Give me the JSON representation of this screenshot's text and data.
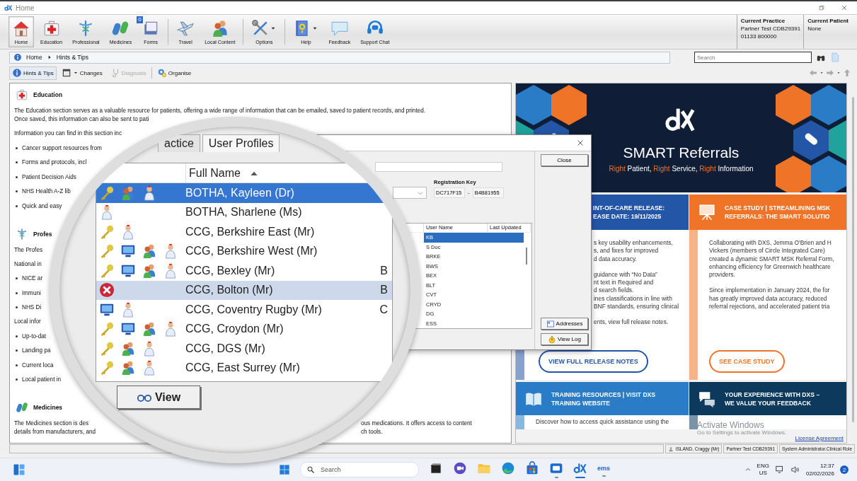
{
  "window": {
    "title": "Home"
  },
  "ribbon": {
    "groups": [
      [
        {
          "label": "Home",
          "selected": true,
          "dropdown": false
        },
        {
          "label": "Education",
          "selected": false,
          "dropdown": false
        },
        {
          "label": "Professional",
          "selected": false,
          "dropdown": false
        },
        {
          "label": "Medicines",
          "selected": false,
          "dropdown": false
        },
        {
          "label": "Forms",
          "selected": false,
          "dropdown": false,
          "badge": "0"
        }
      ],
      [
        {
          "label": "Travel",
          "selected": false,
          "dropdown": false
        },
        {
          "label": "Local Content",
          "selected": false,
          "dropdown": false
        }
      ],
      [
        {
          "label": "Options",
          "selected": false,
          "dropdown": true
        }
      ],
      [
        {
          "label": "Help",
          "selected": false,
          "dropdown": true
        },
        {
          "label": "Feedback",
          "selected": false,
          "dropdown": false
        },
        {
          "label": "Support Chat",
          "selected": false,
          "dropdown": false
        }
      ]
    ]
  },
  "context": [
    {
      "label": "Current Practice",
      "lines": [
        "Partner Test CDB29391",
        "01133 800000"
      ]
    },
    {
      "label": "Current Patient",
      "lines": [
        "None"
      ]
    }
  ],
  "breadcrumb": [
    "Home",
    "Hints & Tips"
  ],
  "search": {
    "placeholder": "Search"
  },
  "toolbar": [
    {
      "label": "Hints & Tips",
      "selected": true,
      "disabled": false,
      "dropdown": false
    },
    {
      "label": "Changes",
      "selected": false,
      "disabled": false,
      "dropdown": true
    },
    {
      "label": "Diagnosis",
      "selected": false,
      "disabled": true,
      "dropdown": false
    },
    {
      "label": "Organise",
      "selected": false,
      "disabled": false,
      "dropdown": false
    }
  ],
  "sections": [
    {
      "heading": "Education",
      "blocks": [
        {
          "kind": "para",
          "lines": [
            "The Education section serves as a valuable resource for patients, offering a wide range of information that can be emailed, saved to patient records, and printed.",
            "Once saved, this information can also be sent to pati"
          ]
        },
        {
          "kind": "para",
          "lines": [
            "Information you can find in this section inc"
          ]
        },
        {
          "kind": "bullets",
          "items": [
            "Cancer support resources from",
            "Forms and protocols, incl",
            "Patient Decision Aids",
            "NHS Health A-Z lib",
            "Quick and easy"
          ]
        }
      ]
    },
    {
      "heading": "Profes",
      "blocks": [
        {
          "kind": "para",
          "lines": [
            "The Profes"
          ]
        },
        {
          "kind": "para",
          "lines": [
            "National in"
          ]
        },
        {
          "kind": "bullets",
          "items": [
            "NICE ar",
            "Immuni",
            "NHS Di"
          ]
        },
        {
          "kind": "para",
          "lines": [
            "Local infor"
          ]
        },
        {
          "kind": "bullets",
          "items": [
            "Up-to-dat",
            "Landing pa",
            "Current loca",
            "Local patient in"
          ]
        }
      ]
    },
    {
      "heading": "Medicines",
      "blocks": [
        {
          "kind": "split",
          "lines": [
            {
              "left": "The Medicines section is des",
              "right": "ous medications. It offers access to content"
            },
            {
              "left": "details from manufacturers, and",
              "right": "ch tools."
            }
          ]
        }
      ]
    }
  ],
  "banner": {
    "title": "SMART Referrals",
    "tagline": [
      {
        "text": "Right",
        "accent": true
      },
      {
        "text": " Patient, ",
        "accent": false
      },
      {
        "text": "Right",
        "accent": true
      },
      {
        "text": " Service, ",
        "accent": false
      },
      {
        "text": "Right",
        "accent": true
      },
      {
        "text": " Information",
        "accent": false
      }
    ]
  },
  "cards": [
    [
      {
        "color": "#2456a8",
        "title_lines": [
          "INT-OF-CARE RELEASE:",
          "EASE DATE: 19/11/2025"
        ],
        "body": [
          [
            "s key usability enhancements,",
            "s, and fixes for improved",
            "d data accuracy."
          ],
          [
            "guidance with “No Data”",
            "nt text in Required and",
            "d search fields.",
            "ines classifications in line with",
            "BNF standards, ensuring clinical"
          ],
          [
            "ents, view full release notes."
          ]
        ],
        "button": "VIEW FULL RELEASE NOTES"
      },
      {
        "color": "#f07427",
        "title_lines": [
          "CASE STUDY | STREAMLINING MSK",
          "REFERRALS: THE SMART SOLUTIO"
        ],
        "body": [
          [
            "Collaborating with DXS, Jemma O'Brien and H",
            "Vickers (members of Circle Integrated Care)",
            "created a dynamic SMART MSK Referral Form,",
            "enhancing efficiency for Greenwich healthcare",
            "providers."
          ],
          [
            "Since implementation in January 2024, the for",
            "has greatly improved data accuracy, reduced",
            "referral rejections, and accelerated patient tria"
          ]
        ],
        "button": "SEE CASE STUDY"
      }
    ],
    [
      {
        "color": "#2a7cc7",
        "title_lines": [
          "TRAINING RESOURCES | VISIT DXS",
          "TRAINING WEBSITE"
        ],
        "body": [
          [
            "Discover how to access quick assistance using the"
          ]
        ]
      },
      {
        "color": "#0d3a5c",
        "title_lines": [
          "YOUR EXPERIENCE WITH DXS –",
          "WE VALUE YOUR FEEDBACK"
        ]
      }
    ]
  ],
  "license": "License Agreement",
  "os_notice": {
    "title": "Activate Windows",
    "subtitle": "Go to Settings to activate Windows."
  },
  "dialog": {
    "top_buttons": [
      {
        "label": "Close"
      }
    ],
    "bottom_buttons": [
      {
        "label": "Addresses"
      },
      {
        "label": "View Log"
      }
    ],
    "registration": {
      "label": "Registration Key",
      "parts": [
        "DC717F15",
        "B4B81955"
      ],
      "separator": "-"
    },
    "list": {
      "columns": [
        "User Name",
        "Last Updated"
      ],
      "rows": [
        {
          "user_name": "KB",
          "selected": true
        },
        {
          "user_name": "S Doc",
          "selected": false
        },
        {
          "user_name": "BRKE",
          "selected": false
        },
        {
          "user_name": "BWS",
          "selected": false
        },
        {
          "user_name": "BEX",
          "selected": false
        },
        {
          "user_name": "BLT",
          "selected": false
        },
        {
          "user_name": "CVT",
          "selected": false
        },
        {
          "user_name": "CRYD",
          "selected": false
        },
        {
          "user_name": "DG",
          "selected": false
        },
        {
          "user_name": "ESS",
          "selected": false
        }
      ]
    }
  },
  "magnifier": {
    "tabs": [
      {
        "label": "actice",
        "selected": false
      },
      {
        "label": "User Profiles",
        "selected": true
      }
    ],
    "column": {
      "label": "Full Name",
      "sorted_ascending": true
    },
    "rows": [
      {
        "icons": [
          {
            "kind": "key"
          },
          {
            "kind": "people"
          },
          {
            "kind": "doctor"
          }
        ],
        "name": "BOTHA, Kayleen (Dr)",
        "selected": true,
        "highlighted": false
      },
      {
        "icons": [
          {
            "kind": "doctor"
          }
        ],
        "name": "BOTHA, Sharlene (Ms)",
        "selected": false,
        "highlighted": false
      },
      {
        "icons": [
          {
            "kind": "key"
          },
          {
            "kind": "doctor"
          }
        ],
        "name": "CCG, Berkshire East (Mr)",
        "selected": false,
        "highlighted": false
      },
      {
        "icons": [
          {
            "kind": "key"
          },
          {
            "kind": "monitor"
          },
          {
            "kind": "people"
          },
          {
            "kind": "doctor"
          }
        ],
        "name": "CCG, Berkshire West (Mr)",
        "selected": false,
        "highlighted": false
      },
      {
        "icons": [
          {
            "kind": "key"
          },
          {
            "kind": "monitor"
          },
          {
            "kind": "people"
          },
          {
            "kind": "doctor"
          }
        ],
        "name": "CCG, Bexley (Mr)",
        "column_2": "B",
        "selected": false,
        "highlighted": false
      },
      {
        "icons": [
          {
            "kind": "error"
          }
        ],
        "name": "CCG, Bolton (Mr)",
        "column_2": "B",
        "selected": false,
        "highlighted": true
      },
      {
        "icons": [
          {
            "kind": "monitor"
          },
          {
            "kind": "doctor"
          }
        ],
        "name": "CCG, Coventry Rugby (Mr)",
        "column_2": "C",
        "selected": false,
        "highlighted": false
      },
      {
        "icons": [
          {
            "kind": "key"
          },
          {
            "kind": "monitor"
          },
          {
            "kind": "people"
          },
          {
            "kind": "doctor"
          }
        ],
        "name": "CCG, Croydon (Mr)",
        "selected": false,
        "highlighted": false
      },
      {
        "icons": [
          {
            "kind": "key"
          },
          {
            "kind": "people"
          },
          {
            "kind": "doctor"
          }
        ],
        "name": "CCG, DGS (Mr)",
        "selected": false,
        "highlighted": false
      },
      {
        "icons": [
          {
            "kind": "key"
          },
          {
            "kind": "people"
          },
          {
            "kind": "doctor"
          }
        ],
        "name": "CCG, East Surrey (Mr)",
        "selected": false,
        "highlighted": false
      }
    ],
    "button": {
      "label": "View"
    }
  },
  "status_bar": {
    "user": "ISLAND, Craggy (Mr)",
    "practice": "Partner Test CDB29391",
    "role": "System Administrator.Clinical Role"
  },
  "taskbar": {
    "search": {
      "placeholder": "Search"
    },
    "apps": [
      {
        "running": false,
        "active": false
      },
      {
        "running": false,
        "active": false
      },
      {
        "running": false,
        "active": false
      },
      {
        "running": false,
        "active": false
      },
      {
        "running": false,
        "active": false
      },
      {
        "running": true,
        "active": false
      },
      {
        "running": true,
        "active": true
      },
      {
        "label": "ems",
        "running": true,
        "active": false
      }
    ],
    "language": "ENG",
    "region": "US",
    "time": "12:37",
    "date": "02/02/2026",
    "notifications": "2"
  }
}
